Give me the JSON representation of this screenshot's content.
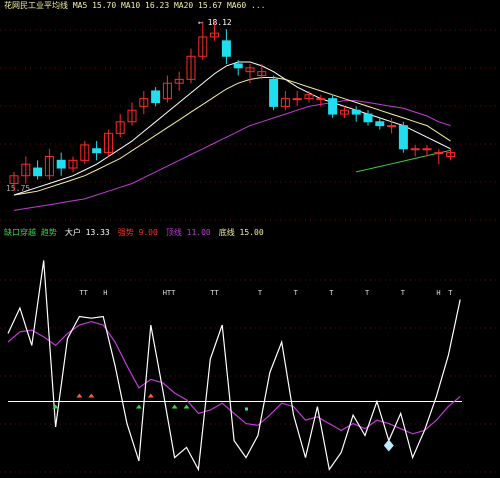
{
  "colors": {
    "background": "#000000",
    "grid": "#7a0000",
    "up_candle": "#ff2a2a",
    "down_candle": "#22ddf0",
    "ma_white": "#ffffff",
    "ma_yellow": "#f5f0a0",
    "ma_magenta": "#c23bd6",
    "ma_green": "#39d34a",
    "osc_line": "#ffffff",
    "osc_signal": "#c23bd6",
    "baseline": "#ffffff"
  },
  "price_panel": {
    "header_text": "花网民工业平均线 MA5 15.70 MA10 16.23 MA20 15.67 MA60 ...",
    "peak_label": "← 18.12",
    "side_label": "15.75",
    "candles": [
      {
        "o": 13.9,
        "c": 14.1,
        "h": 14.2,
        "l": 13.7
      },
      {
        "o": 14.1,
        "c": 14.4,
        "h": 14.6,
        "l": 13.9
      },
      {
        "o": 14.3,
        "c": 14.1,
        "h": 14.5,
        "l": 14.0
      },
      {
        "o": 14.1,
        "c": 14.6,
        "h": 14.8,
        "l": 14.0
      },
      {
        "o": 14.5,
        "c": 14.3,
        "h": 14.7,
        "l": 14.1
      },
      {
        "o": 14.3,
        "c": 14.5,
        "h": 14.6,
        "l": 14.2
      },
      {
        "o": 14.5,
        "c": 14.9,
        "h": 15.0,
        "l": 14.4
      },
      {
        "o": 14.8,
        "c": 14.7,
        "h": 15.0,
        "l": 14.5
      },
      {
        "o": 14.7,
        "c": 15.2,
        "h": 15.3,
        "l": 14.6
      },
      {
        "o": 15.2,
        "c": 15.5,
        "h": 15.7,
        "l": 15.1
      },
      {
        "o": 15.5,
        "c": 15.8,
        "h": 16.0,
        "l": 15.4
      },
      {
        "o": 15.9,
        "c": 16.1,
        "h": 16.3,
        "l": 15.7
      },
      {
        "o": 16.3,
        "c": 16.0,
        "h": 16.4,
        "l": 15.9
      },
      {
        "o": 16.1,
        "c": 16.5,
        "h": 16.7,
        "l": 16.0
      },
      {
        "o": 16.5,
        "c": 16.6,
        "h": 16.8,
        "l": 16.3
      },
      {
        "o": 16.6,
        "c": 17.2,
        "h": 17.4,
        "l": 16.5
      },
      {
        "o": 17.2,
        "c": 17.7,
        "h": 18.1,
        "l": 17.1
      },
      {
        "o": 17.7,
        "c": 17.8,
        "h": 18.12,
        "l": 17.6
      },
      {
        "o": 17.6,
        "c": 17.2,
        "h": 17.9,
        "l": 17.0
      },
      {
        "o": 17.0,
        "c": 16.9,
        "h": 17.1,
        "l": 16.7
      },
      {
        "o": 16.8,
        "c": 16.9,
        "h": 17.0,
        "l": 16.5
      },
      {
        "o": 16.7,
        "c": 16.8,
        "h": 17.0,
        "l": 16.6
      },
      {
        "o": 16.6,
        "c": 15.9,
        "h": 16.7,
        "l": 15.8
      },
      {
        "o": 15.9,
        "c": 16.1,
        "h": 16.3,
        "l": 15.8
      },
      {
        "o": 16.1,
        "c": 16.1,
        "h": 16.3,
        "l": 15.9
      },
      {
        "o": 16.1,
        "c": 16.2,
        "h": 16.3,
        "l": 16.0
      },
      {
        "o": 16.1,
        "c": 16.1,
        "h": 16.2,
        "l": 15.9
      },
      {
        "o": 16.1,
        "c": 15.7,
        "h": 16.2,
        "l": 15.6
      },
      {
        "o": 15.7,
        "c": 15.8,
        "h": 15.9,
        "l": 15.6
      },
      {
        "o": 15.8,
        "c": 15.7,
        "h": 15.9,
        "l": 15.5
      },
      {
        "o": 15.7,
        "c": 15.5,
        "h": 15.8,
        "l": 15.4
      },
      {
        "o": 15.5,
        "c": 15.4,
        "h": 15.6,
        "l": 15.3
      },
      {
        "o": 15.4,
        "c": 15.4,
        "h": 15.6,
        "l": 15.2
      },
      {
        "o": 15.4,
        "c": 14.8,
        "h": 15.5,
        "l": 14.7
      },
      {
        "o": 14.8,
        "c": 14.8,
        "h": 14.9,
        "l": 14.6
      },
      {
        "o": 14.8,
        "c": 14.8,
        "h": 14.9,
        "l": 14.6
      },
      {
        "o": 14.7,
        "c": 14.7,
        "h": 14.8,
        "l": 14.4
      },
      {
        "o": 14.6,
        "c": 14.7,
        "h": 14.8,
        "l": 14.5
      }
    ],
    "ma_white": [
      13.6,
      13.7,
      13.8,
      13.9,
      14.0,
      14.1,
      14.25,
      14.4,
      14.6,
      14.8,
      15.0,
      15.25,
      15.5,
      15.75,
      16.0,
      16.25,
      16.5,
      16.75,
      16.95,
      17.05,
      17.05,
      16.95,
      16.8,
      16.6,
      16.4,
      16.25,
      16.1,
      16.0,
      15.9,
      15.8,
      15.7,
      15.6,
      15.5,
      15.4,
      15.25,
      15.1,
      14.95,
      14.8
    ],
    "ma_yellow": [
      13.6,
      13.65,
      13.7,
      13.8,
      13.9,
      14.0,
      14.1,
      14.25,
      14.4,
      14.55,
      14.75,
      14.95,
      15.15,
      15.35,
      15.55,
      15.75,
      15.95,
      16.15,
      16.35,
      16.5,
      16.6,
      16.65,
      16.65,
      16.6,
      16.5,
      16.4,
      16.3,
      16.2,
      16.1,
      16.0,
      15.9,
      15.8,
      15.7,
      15.6,
      15.5,
      15.4,
      15.2,
      15.0
    ],
    "ma_magenta": [
      13.2,
      13.25,
      13.3,
      13.35,
      13.4,
      13.45,
      13.5,
      13.6,
      13.7,
      13.8,
      13.9,
      14.05,
      14.2,
      14.35,
      14.5,
      14.65,
      14.8,
      14.95,
      15.1,
      15.25,
      15.4,
      15.5,
      15.6,
      15.7,
      15.8,
      15.9,
      15.95,
      16.0,
      16.05,
      16.05,
      16.0,
      15.95,
      15.9,
      15.85,
      15.75,
      15.65,
      15.5,
      15.4
    ],
    "ma_green": [
      null,
      null,
      null,
      null,
      null,
      null,
      null,
      null,
      null,
      null,
      null,
      null,
      null,
      null,
      null,
      null,
      null,
      null,
      null,
      null,
      null,
      null,
      null,
      null,
      null,
      null,
      null,
      null,
      null,
      14.2,
      14.27,
      14.34,
      14.41,
      14.48,
      14.55,
      14.62,
      14.69,
      14.76
    ],
    "ylim": [
      12.9,
      18.4
    ]
  },
  "osc_panel": {
    "header_items": [
      {
        "text": "缺口穿越 趋势",
        "color": "#39d34a"
      },
      {
        "text": "大户 13.33",
        "color": "#ffffff"
      },
      {
        "text": "强势 9.00",
        "color": "#ff2a2a"
      },
      {
        "text": "顶线 11.00",
        "color": "#c23bd6"
      },
      {
        "text": "底线 15.00",
        "color": "#f5f0a0"
      }
    ],
    "white_line": [
      55,
      40,
      62,
      12,
      110,
      58,
      45,
      46,
      45,
      74,
      108,
      130,
      50,
      88,
      128,
      122,
      135,
      70,
      50,
      118,
      128,
      115,
      78,
      60,
      103,
      128,
      98,
      135,
      125,
      103,
      115,
      95,
      118,
      102,
      128,
      112,
      92,
      68,
      35
    ],
    "magenta_line": [
      60,
      54,
      53,
      57,
      62,
      55,
      50,
      48,
      50,
      60,
      74,
      87,
      82,
      84,
      90,
      94,
      102,
      100,
      96,
      102,
      108,
      109,
      103,
      96,
      98,
      106,
      104,
      108,
      112,
      108,
      111,
      106,
      108,
      111,
      114,
      112,
      106,
      98,
      92
    ],
    "baseline_value": 95,
    "ylim": [
      0,
      140
    ],
    "markers": [
      {
        "t": "green_up",
        "i": 4
      },
      {
        "t": "red_up",
        "i": 6
      },
      {
        "t": "red_up",
        "i": 7
      },
      {
        "t": "green_up",
        "i": 11
      },
      {
        "t": "red_up",
        "i": 12
      },
      {
        "t": "green_up",
        "i": 14
      },
      {
        "t": "green_up",
        "i": 15
      },
      {
        "t": "cyan_dot",
        "i": 20
      },
      {
        "t": "diamond",
        "i": 32
      }
    ],
    "tick_labels": [
      {
        "i": 6,
        "text": "TT"
      },
      {
        "i": 8,
        "text": "H"
      },
      {
        "i": 13,
        "text": "HTT"
      },
      {
        "i": 17,
        "text": "TT"
      },
      {
        "i": 21,
        "text": "T"
      },
      {
        "i": 24,
        "text": "T"
      },
      {
        "i": 27,
        "text": "T"
      },
      {
        "i": 30,
        "text": "T"
      },
      {
        "i": 33,
        "text": "T"
      },
      {
        "i": 36,
        "text": "H"
      },
      {
        "i": 37,
        "text": "T"
      }
    ]
  }
}
